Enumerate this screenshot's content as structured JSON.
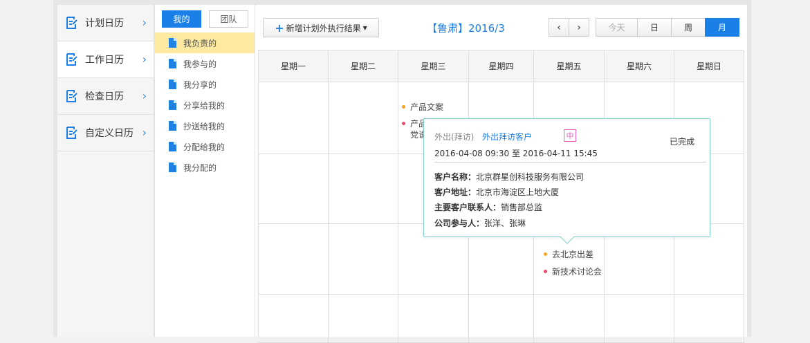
{
  "left_nav": {
    "items": [
      {
        "label": "计划日历",
        "icon": "calendar-edit-icon"
      },
      {
        "label": "工作日历",
        "icon": "calendar-edit-icon"
      },
      {
        "label": "检查日历",
        "icon": "calendar-edit-icon"
      },
      {
        "label": "自定义日历",
        "icon": "calendar-edit-icon"
      }
    ]
  },
  "sub_nav": {
    "tabs": [
      "我的",
      "团队"
    ],
    "items": [
      "我负责的",
      "我参与的",
      "我分享的",
      "分享给我的",
      "抄送给我的",
      "分配给我的",
      "我分配的"
    ]
  },
  "toolbar": {
    "add_label": "新增计划外执行结果",
    "title": "【鲁肃】2016/3",
    "prev": "‹",
    "next": "›",
    "views": [
      "今天",
      "日",
      "周",
      "月"
    ]
  },
  "calendar": {
    "weekdays": [
      "星期一",
      "星期二",
      "星期三",
      "星期四",
      "星期五",
      "星期六",
      "星期日"
    ],
    "events": {
      "wed_1": "产品文案",
      "wed_2a": "产品",
      "wed_2b": "党说",
      "fri_1": "去北京出差",
      "fri_2": "新技术讨论会"
    }
  },
  "popup": {
    "type": "外出(拜访)",
    "link": "外出拜访客户",
    "priority": "中",
    "status": "已完成",
    "time": "2016-04-08 09:30 至 2016-04-11 15:45",
    "fields": [
      {
        "k": "客户名称：",
        "v": "北京群星创科技服务有限公司"
      },
      {
        "k": "客户地址：",
        "v": "北京市海淀区上地大厦"
      },
      {
        "k": "主要客户联系人：",
        "v": "销售部总监"
      },
      {
        "k": "公司参与人：",
        "v": "张洋、张琳"
      }
    ]
  },
  "colors": {
    "accent": "#1a7fe6",
    "orange_dot": "#f5a623",
    "red_dot": "#e84b6a",
    "popup_border": "#7fd0c6"
  }
}
